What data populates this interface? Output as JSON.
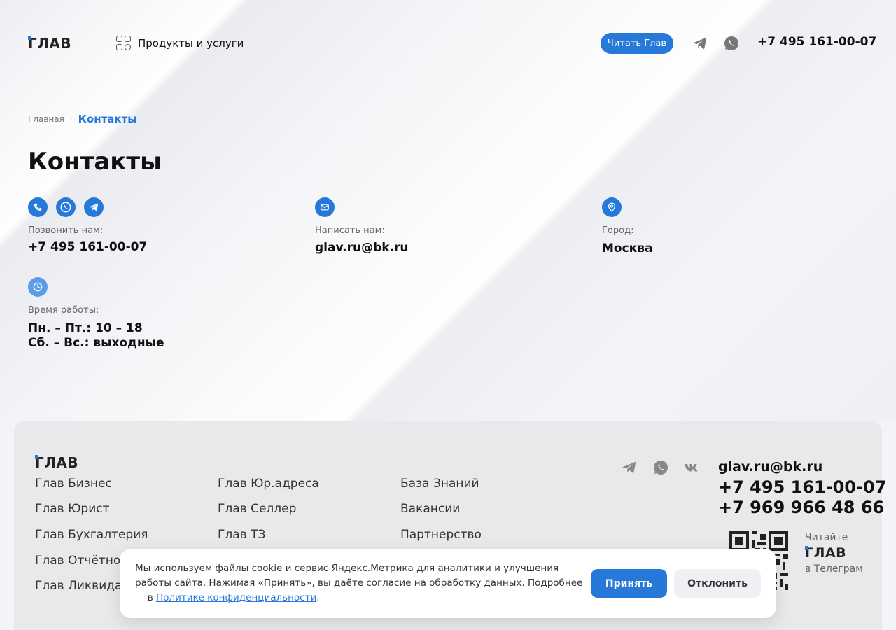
{
  "header": {
    "logo": "ГЛАВ",
    "products_label": "Продукты и услуги",
    "read_button": "Читать Глав",
    "phone": "+7 495 161-00-07"
  },
  "breadcrumb": {
    "home": "Главная",
    "separator": "·",
    "current": "Контакты"
  },
  "page_title": "Контакты",
  "contacts": {
    "call": {
      "label": "Позвонить нам:",
      "value": "+7 495 161-00-07"
    },
    "write": {
      "label": "Написать нам:",
      "value": "glav.ru@bk.ru"
    },
    "city": {
      "label": "Город:",
      "value": "Москва"
    },
    "hours": {
      "label": "Время работы:",
      "line1": "Пн. – Пт.: 10 – 18",
      "line2": "Сб. – Вс.: выходные"
    }
  },
  "footer": {
    "logo": "ГЛАВ",
    "col1": [
      "Глав Бизнес",
      "Глав Юрист",
      "Глав Бухгалтерия",
      "Глав Отчётнос",
      "Глав Ликвида"
    ],
    "col2": [
      "Глав Юр.адреса",
      "Глав Селлер",
      "Глав ТЗ"
    ],
    "col3": [
      "База Знаний",
      "Вакансии",
      "Партнерство"
    ],
    "email": "glav.ru@bk.ru",
    "phone1": "+7 495 161-00-07",
    "phone2": "+7 969 966 48 66",
    "qr_read": "Читайте",
    "qr_logo": "ГЛАВ",
    "qr_telegram": "в Телеграм"
  },
  "cookie": {
    "text": "Мы используем файлы cookie и сервис Яндекс.Метрика для аналитики и улучшения работы сайта. Нажимая «Принять», вы даёте согласие на обработку данных. Подробнее — в ",
    "link": "Политике конфиденциальности",
    "tail": ".",
    "accept": "Принять",
    "decline": "Отклонить"
  },
  "colors": {
    "accent": "#2679d8",
    "footer_bg": "#e9e9eb",
    "text": "#111111"
  },
  "icons": {
    "header": [
      "telegram-icon",
      "whatsapp-icon"
    ],
    "contacts": [
      "phone-icon",
      "whatsapp-icon",
      "telegram-icon",
      "mail-icon",
      "location-icon",
      "clock-icon"
    ],
    "footer": [
      "telegram-icon",
      "whatsapp-icon",
      "vk-icon"
    ]
  }
}
